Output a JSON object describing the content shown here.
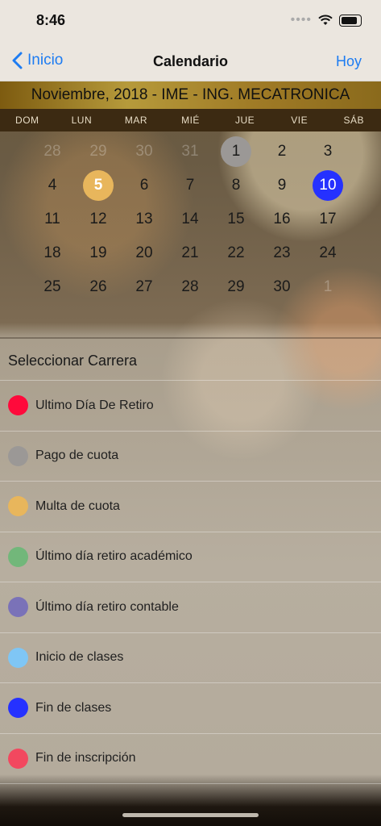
{
  "status": {
    "time": "8:46",
    "dots": "••••"
  },
  "nav": {
    "back_label": "Inicio",
    "title": "Calendario",
    "today_label": "Hoy"
  },
  "calendar": {
    "header": "Noviembre, 2018 - IME - ING. MECATRONICA",
    "weekdays": [
      "DOM",
      "LUN",
      "MAR",
      "MIÉ",
      "JUE",
      "VIE",
      "SÁB"
    ],
    "weeks": [
      [
        {
          "d": "28",
          "dim": true
        },
        {
          "d": "29",
          "dim": true
        },
        {
          "d": "30",
          "dim": true
        },
        {
          "d": "31",
          "dim": true
        },
        {
          "d": "1",
          "mark": "#9b9896"
        },
        {
          "d": "2"
        },
        {
          "d": "3"
        }
      ],
      [
        {
          "d": "4"
        },
        {
          "d": "5",
          "mark": "#e8b65c",
          "today": true
        },
        {
          "d": "6"
        },
        {
          "d": "7"
        },
        {
          "d": "8"
        },
        {
          "d": "9"
        },
        {
          "d": "10",
          "mark": "#2531ff",
          "selected": true
        }
      ],
      [
        {
          "d": "11"
        },
        {
          "d": "12"
        },
        {
          "d": "13"
        },
        {
          "d": "14"
        },
        {
          "d": "15"
        },
        {
          "d": "16"
        },
        {
          "d": "17"
        }
      ],
      [
        {
          "d": "18"
        },
        {
          "d": "19"
        },
        {
          "d": "20"
        },
        {
          "d": "21"
        },
        {
          "d": "22"
        },
        {
          "d": "23"
        },
        {
          "d": "24"
        }
      ],
      [
        {
          "d": "25"
        },
        {
          "d": "26"
        },
        {
          "d": "27"
        },
        {
          "d": "28"
        },
        {
          "d": "29"
        },
        {
          "d": "30"
        },
        {
          "d": "1",
          "dim": true
        }
      ]
    ]
  },
  "section": {
    "title": "Seleccionar Carrera"
  },
  "legend": [
    {
      "label": "Ultimo Día De Retiro",
      "color": "#ff0a3b"
    },
    {
      "label": "Pago de cuota",
      "color": "#9b9896"
    },
    {
      "label": "Multa de cuota",
      "color": "#e8b65c"
    },
    {
      "label": "Último día retiro académico",
      "color": "#72b77a"
    },
    {
      "label": "Último día retiro contable",
      "color": "#7a72b8"
    },
    {
      "label": "Inicio de clases",
      "color": "#7fc6f5"
    },
    {
      "label": "Fin de clases",
      "color": "#2531ff"
    },
    {
      "label": "Fin de inscripción",
      "color": "#f2485f"
    }
  ]
}
